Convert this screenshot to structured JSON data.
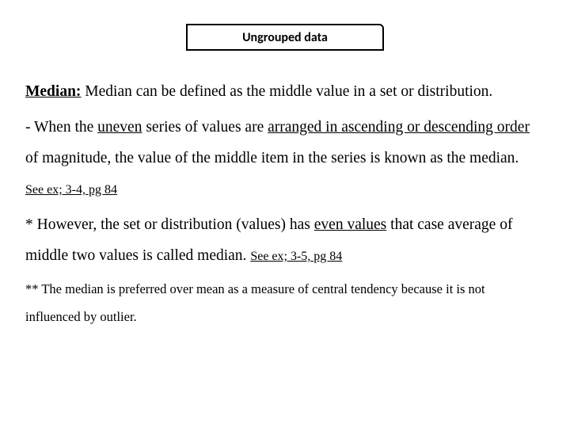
{
  "title": "Ungrouped data",
  "median_label": "Median:",
  "def_part1": " Median can be defined as the middle value in a set or distribution.",
  "bullet_dash": " - When the ",
  "uneven": "uneven",
  "bullet_mid": " series of values are ",
  "arranged": "arranged in ascending or descending order ",
  "bullet_tail": "of magnitude, the value of the middle item in the series is known as the median. ",
  "ref1": "See ex; 3-4, pg 84",
  "however_lead": "* However, the set or distribution (values) has ",
  "even_values": "even values",
  "however_tail": " that case average of middle two values is called median. ",
  "ref2": "See ex; 3-5, pg 84",
  "footnote": "** The median is preferred over mean as a measure of central tendency because it is not influenced by outlier."
}
